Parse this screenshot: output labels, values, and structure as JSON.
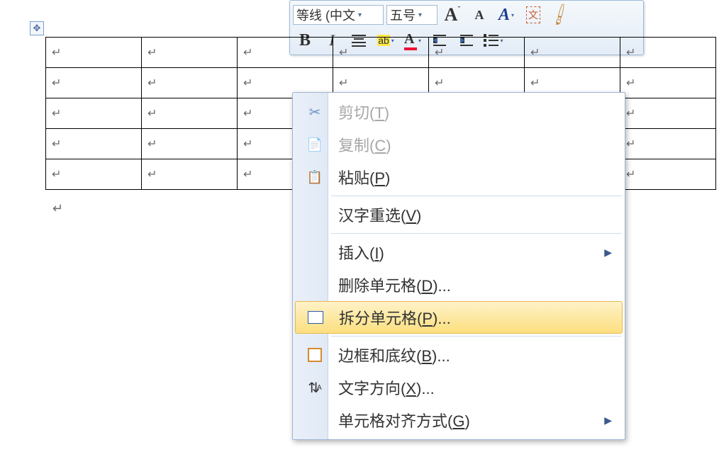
{
  "toolbar": {
    "font_name": "等线 (中文",
    "font_size": "五号",
    "grow_font": "A",
    "shrink_font": "A",
    "style": "A",
    "char_border": "Wen",
    "format_painter": "",
    "bold": "B",
    "italic": "I",
    "highlight": "ab",
    "font_color": "A"
  },
  "table": {
    "rows": 5,
    "cols": 7,
    "cell_mark": "↵"
  },
  "para_mark": "↵",
  "context_menu": {
    "cut": "剪切(T)",
    "copy": "复制(C)",
    "paste": "粘贴(P)",
    "reconvert": "汉字重选(V)",
    "insert": "插入(I)",
    "delete_cells": "删除单元格(D)...",
    "split_cells": "拆分单元格(P)...",
    "borders_shading": "边框和底纹(B)...",
    "text_direction": "文字方向(X)...",
    "cell_alignment": "单元格对齐方式(G)"
  }
}
